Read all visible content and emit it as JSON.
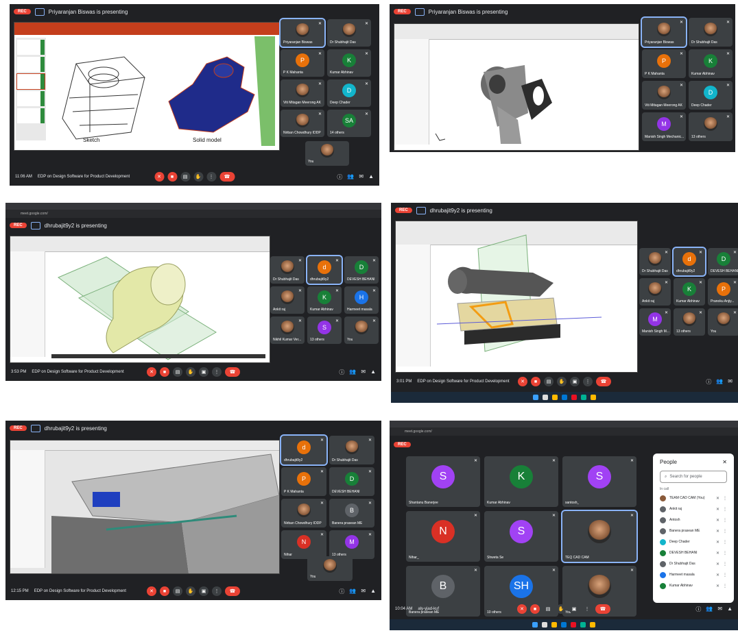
{
  "colors": {
    "meet_bg": "#202124",
    "tile": "#3c4043",
    "rec": "#ea4335",
    "active": "#8ab4f8",
    "ppt": "#c43e1c",
    "green_slide": "#2e8b3d",
    "cad_blue": "#1f2b8a"
  },
  "s1": {
    "rec": "REC",
    "presenting": "Priyaranjan Biswas is presenting",
    "slide": {
      "sketch": "Sketch",
      "solid": "Solid model"
    },
    "tiles": [
      {
        "name": "Priyaranjan Biswas",
        "initial": "",
        "color": "",
        "photo": true,
        "active": true
      },
      {
        "name": "Dr Shubhajit Das",
        "initial": "",
        "color": "",
        "photo": true
      },
      {
        "name": "P K Mahanta",
        "initial": "P",
        "color": "#e8710a"
      },
      {
        "name": "Kumar Abhinav",
        "initial": "K",
        "color": "#188038"
      },
      {
        "name": "Viti Mitagan Meerong AK",
        "initial": "",
        "color": "",
        "photo": true
      },
      {
        "name": "Deep Chader",
        "initial": "D",
        "color": "#12b5cb"
      },
      {
        "name": "Nirban Chowdhury IDDP",
        "initial": "",
        "color": "",
        "photo": true
      },
      {
        "name": "14 others",
        "initial": "SA",
        "color": "#188038"
      }
    ],
    "you": "You",
    "time": "11:06 AM",
    "meeting": "EDP on Design Software for Product Development"
  },
  "s2": {
    "rec": "REC",
    "presenting": "Priyaranjan Biswas is presenting",
    "tiles": [
      {
        "name": "Priyaranjan Biswas",
        "initial": "",
        "color": "",
        "photo": true,
        "active": true
      },
      {
        "name": "Dr Shubhajit Das",
        "initial": "",
        "color": "",
        "photo": true
      },
      {
        "name": "P K Mahanta",
        "initial": "P",
        "color": "#e8710a"
      },
      {
        "name": "Kumar Abhinav",
        "initial": "K",
        "color": "#188038"
      },
      {
        "name": "Viti Mitagan Meerong AK",
        "initial": "",
        "color": "",
        "photo": true
      },
      {
        "name": "Deep Chader",
        "initial": "D",
        "color": "#12b5cb"
      },
      {
        "name": "Manish Singh Mechanic...",
        "initial": "M",
        "color": "#9334e6"
      },
      {
        "name": "13 others",
        "initial": "",
        "color": "",
        "photo": true
      }
    ]
  },
  "s3": {
    "url": "meet.google.com/",
    "rec": "REC",
    "presenting": "dhrubajit9y2 is presenting",
    "tiles": [
      {
        "name": "Dr Shubhajit Das",
        "initial": "",
        "color": "",
        "photo": true
      },
      {
        "name": "dhrubajit9y2",
        "initial": "d",
        "color": "#e8710a",
        "active": true
      },
      {
        "name": "DEVESH BEHANI",
        "initial": "D",
        "color": "#188038"
      },
      {
        "name": "Ankit raj",
        "initial": "",
        "color": "",
        "photo": true
      },
      {
        "name": "Kumar Abhinav",
        "initial": "K",
        "color": "#188038"
      },
      {
        "name": "Harmeet masala",
        "initial": "H",
        "color": "#1a73e8"
      },
      {
        "name": "Nikhil Kumar Ver...",
        "initial": "",
        "color": "",
        "photo": true
      },
      {
        "name": "13 others",
        "initial": "S",
        "color": "#9334e6"
      },
      {
        "name": "You",
        "initial": "",
        "color": "",
        "photo": true
      }
    ],
    "time": "3:53 PM",
    "meeting": "EDP on Design Software for Product Development"
  },
  "s4": {
    "rec": "REC",
    "presenting": "dhrubajit9y2 is presenting",
    "tiles": [
      {
        "name": "Dr Shubhajit Das",
        "initial": "",
        "color": "",
        "photo": true
      },
      {
        "name": "dhrubajit9y2",
        "initial": "d",
        "color": "#e8710a",
        "active": true
      },
      {
        "name": "DEVESH BEHANI",
        "initial": "D",
        "color": "#188038"
      },
      {
        "name": "Ankit raj",
        "initial": "",
        "color": "",
        "photo": true
      },
      {
        "name": "Kumar Abhinav",
        "initial": "K",
        "color": "#188038"
      },
      {
        "name": "Pranoku Anjiy...",
        "initial": "P",
        "color": "#e8710a"
      },
      {
        "name": "Manish Singh M...",
        "initial": "M",
        "color": "#9334e6"
      },
      {
        "name": "13 others",
        "initial": "",
        "color": "",
        "photo": true
      },
      {
        "name": "You",
        "initial": "",
        "color": "",
        "photo": true
      }
    ],
    "time": "3:01 PM",
    "meeting": "EDP on Design Software for Product Development"
  },
  "s5": {
    "rec": "REC",
    "presenting": "dhrubajit9y2 is presenting",
    "tiles": [
      {
        "name": "dhrubajit9y2",
        "initial": "d",
        "color": "#e8710a",
        "active": true
      },
      {
        "name": "Dr Shubhajit Das",
        "initial": "",
        "color": "",
        "photo": true
      },
      {
        "name": "P K Mahanta",
        "initial": "P",
        "color": "#e8710a"
      },
      {
        "name": "DEVESH BEHANI",
        "initial": "D",
        "color": "#188038"
      },
      {
        "name": "Nirban Chowdhury IDDP",
        "initial": "",
        "color": "",
        "photo": true
      },
      {
        "name": "Banera prasean ME",
        "initial": "B",
        "color": "#5f6368"
      },
      {
        "name": "Nihar",
        "initial": "N",
        "color": "#d93025"
      },
      {
        "name": "13 others",
        "initial": "M",
        "color": "#9334e6"
      }
    ],
    "you": "You",
    "time": "12:15 PM",
    "meeting": "EDP on Design Software for Product Development"
  },
  "s6": {
    "url": "meet.google.com/",
    "rec": "REC",
    "tiles": [
      {
        "name": "Shantanu Banerjee",
        "initial": "S",
        "color": "#a142f4"
      },
      {
        "name": "Kumar Abhinav",
        "initial": "K",
        "color": "#188038"
      },
      {
        "name": "santosh_",
        "initial": "S",
        "color": "#a142f4"
      },
      {
        "name": "Nihar_",
        "initial": "N",
        "color": "#d93025"
      },
      {
        "name": "Shweta Se",
        "initial": "S",
        "color": "#a142f4"
      },
      {
        "name": "TEQ CAD CAM",
        "initial": "",
        "color": "",
        "photo": true,
        "active": true
      },
      {
        "name": "Banera prasean ME",
        "initial": "B",
        "color": "#5f6368"
      },
      {
        "name": "10 others",
        "initial": "SH",
        "color": "#1a73e8"
      },
      {
        "name": "You",
        "initial": "",
        "color": "",
        "photo": true
      }
    ],
    "people": {
      "title": "People",
      "search": "Search for people",
      "section": "In call",
      "list": [
        {
          "name": "TEAM CAD CAM (You)",
          "color": "#8a5a3a"
        },
        {
          "name": "Ankit raj",
          "color": "#5f6368"
        },
        {
          "name": "Antosh",
          "color": "#5f6368"
        },
        {
          "name": "Banera prasean ME",
          "color": "#5f6368"
        },
        {
          "name": "Deep Chader",
          "color": "#12b5cb"
        },
        {
          "name": "DEVESH BEHANI",
          "color": "#188038"
        },
        {
          "name": "Dr Shubhajit Das",
          "color": "#5f6368"
        },
        {
          "name": "Harmeet masala",
          "color": "#1a73e8"
        },
        {
          "name": "Kumar Abhinav",
          "color": "#188038"
        }
      ]
    },
    "time": "10:04 AM",
    "meeting": "aly-yjad-kuf"
  }
}
